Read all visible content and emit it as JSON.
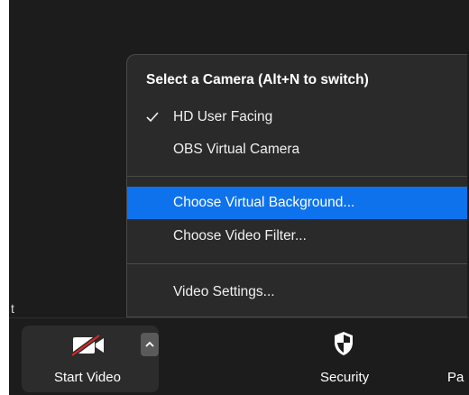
{
  "stray_text": "t",
  "camera_menu": {
    "header": "Select a Camera (Alt+N to switch)",
    "cameras": [
      {
        "label": "HD User Facing",
        "checked": true
      },
      {
        "label": "OBS Virtual Camera",
        "checked": false
      }
    ],
    "actions": [
      {
        "label": "Choose Virtual Background...",
        "highlighted": true
      },
      {
        "label": "Choose Video Filter...",
        "highlighted": false
      }
    ],
    "settings": {
      "label": "Video Settings..."
    }
  },
  "toolbar": {
    "start_video_label": "Start Video",
    "security_label": "Security",
    "participants_label_partial": "Pa"
  },
  "colors": {
    "menu_highlight": "#0e72ed",
    "muted_slash": "#e02828"
  }
}
